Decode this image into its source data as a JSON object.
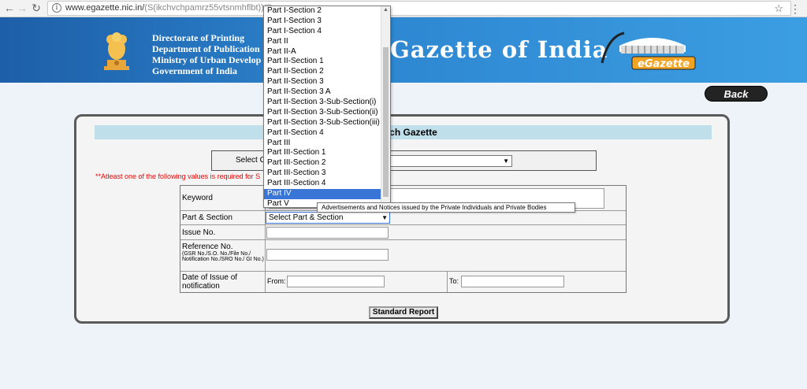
{
  "browser": {
    "url_host": "www.egazette.nic.in/",
    "url_path": "(S(ikchvchpamrz55vtsnmhflbt))/S..."
  },
  "header": {
    "dept_lines": [
      "Directorate of Printing",
      "Department of Publication",
      "Ministry of Urban Develop",
      "Government of India"
    ],
    "title": "Gazette of India",
    "logo_text": "eGazette",
    "colors": {
      "banner": "#2d86d0",
      "accent": "#3875d7"
    }
  },
  "back_label": "Back",
  "form": {
    "title": "Search Gazette",
    "category_label": "Select C",
    "required_note": "**Atleast one of the following values is required for S",
    "fields": {
      "keyword": "Keyword",
      "part_section": "Part & Section",
      "part_select_value": "Select Part & Section",
      "issue_no": "Issue No.",
      "reference_no": "Reference No.",
      "reference_sub": "(GSR No./S.O. No./File No./ Notification No./SRO No./ GI No.)",
      "date_issue": "Date of Issue of notification",
      "from": "From:",
      "to": "To:"
    },
    "submit_label": "Standard Report"
  },
  "dropdown": {
    "options": [
      "Part I-Section 2",
      "Part I-Section 3",
      "Part I-Section 4",
      "Part II",
      "Part II-A",
      "Part II-Section 1",
      "Part II-Section 2",
      "Part II-Section 3",
      "Part II-Section 3 A",
      "Part II-Section 3-Sub-Section(i)",
      "Part II-Section 3-Sub-Section(ii)",
      "Part II-Section 3-Sub-Section(iii)",
      "Part II-Section 4",
      "Part III",
      "Part III-Section 1",
      "Part III-Section 2",
      "Part III-Section 3",
      "Part III-Section 4",
      "Part IV",
      "Part V"
    ],
    "selected": "Part IV",
    "tooltip": "Advertisements and Notices issued by the Private Individuals and Private Bodies"
  }
}
